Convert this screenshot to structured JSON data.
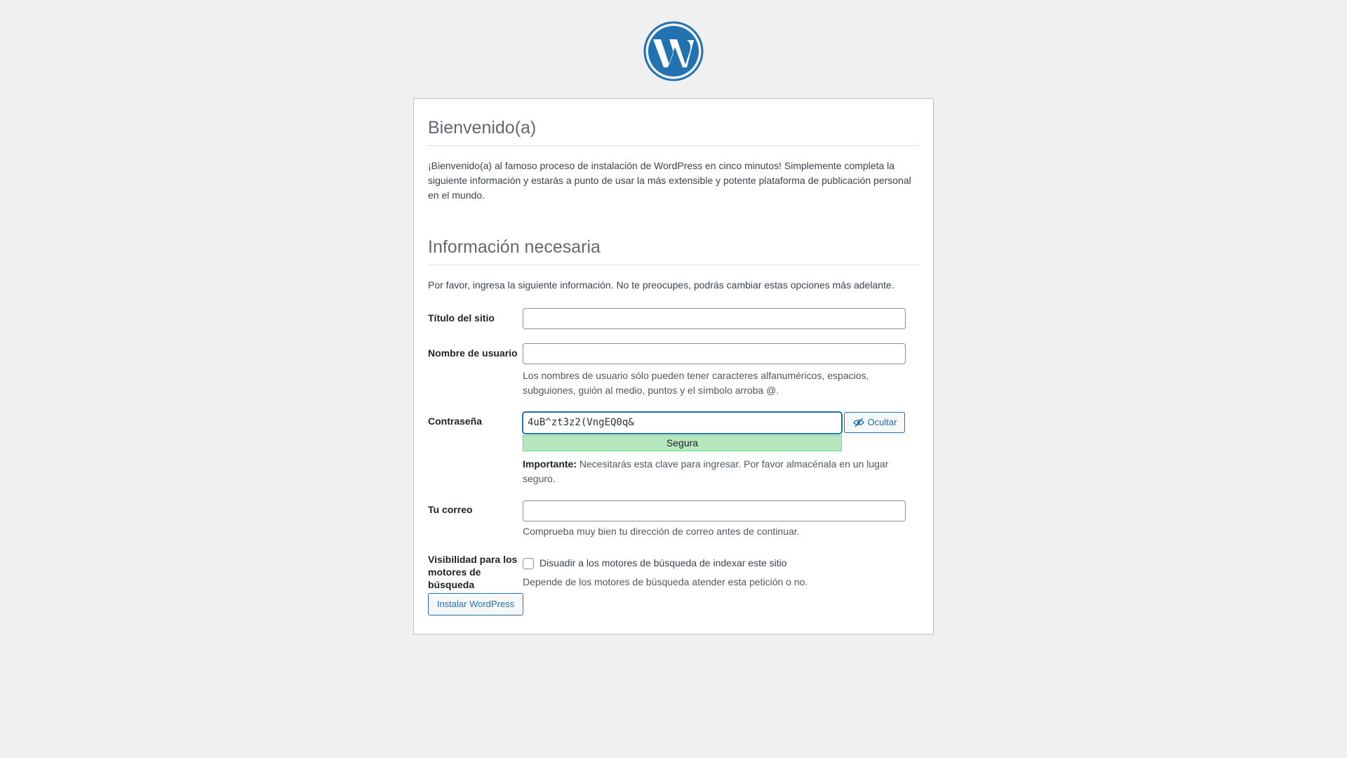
{
  "colors": {
    "background": "#f0f0f1",
    "accent": "#2271b1",
    "logo": "#2271b1",
    "strength_good_bg": "#b8e6bf",
    "strength_good_border": "#68de7c"
  },
  "logo": {
    "icon": "wordpress-logo-icon"
  },
  "welcome": {
    "title": "Bienvenido(a)",
    "text": "¡Bienvenido(a) al famoso proceso de instalación de WordPress en cinco minutos! Simplemente completa la siguiente información y estarás a punto de usar la más extensible y potente plataforma de publicación personal en el mundo."
  },
  "info": {
    "title": "Información necesaria",
    "text": "Por favor, ingresa la siguiente información. No te preocupes, podrás cambiar estas opciones más adelante."
  },
  "form": {
    "site_title": {
      "label": "Título del sitio",
      "value": ""
    },
    "username": {
      "label": "Nombre de usuario",
      "value": "",
      "description": "Los nombres de usuario sólo pueden tener caracteres alfanuméricos, espacios, subguiones, guión al medio, puntos y el símbolo arroba @."
    },
    "password": {
      "label": "Contraseña",
      "value": "4uB^zt3z2(VngEQ0q&",
      "toggle_label": "Ocultar",
      "toggle_icon": "eye-slash-icon",
      "strength": "Segura",
      "important_label": "Importante:",
      "important_text": " Necesitarás esta clave para ingresar. Por favor almacénala en un lugar seguro."
    },
    "email": {
      "label": "Tu correo",
      "value": "",
      "description": "Comprueba muy bien tu dirección de correo antes de continuar."
    },
    "visibility": {
      "label": "Visibilidad para los motores de búsqueda",
      "checkbox_label": "Disuadir a los motores de búsqueda de indexar este sitio",
      "checked": false,
      "description": "Depende de los motores de búsqueda atender esta petición o no."
    },
    "submit_label": "Instalar WordPress"
  }
}
